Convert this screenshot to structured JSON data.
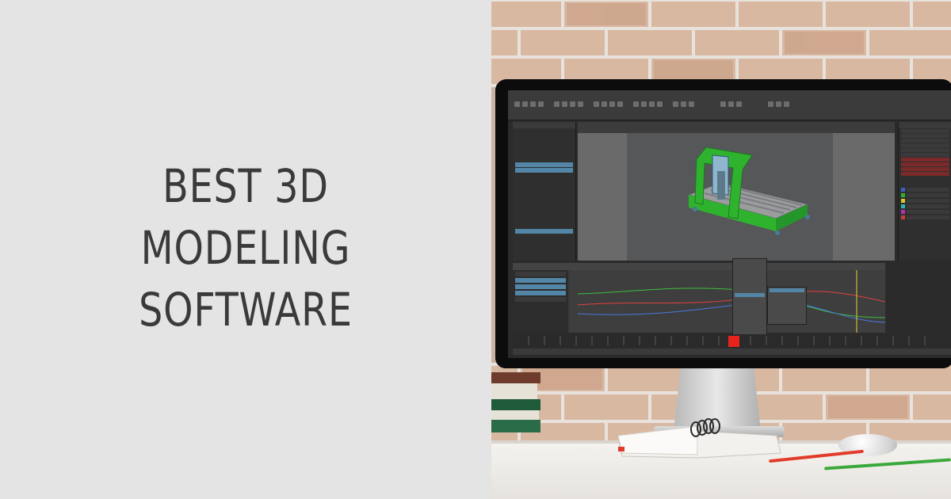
{
  "headline": {
    "line1": "BEST  3D",
    "line2": "MODELING",
    "line3": "SOFTWARE"
  },
  "colors": {
    "left_background": "#e4e4e4",
    "headline_text": "#3a3a3a",
    "model_green": "#2fb32f",
    "model_grey": "#9c9ea0",
    "timeline_marker": "#e8231c",
    "selection_blue": "#5285a6"
  },
  "photo": {
    "description_icons": [
      "monitor-icon",
      "brick-wall",
      "notebook-icon",
      "mouse-icon",
      "pencil-icon"
    ]
  }
}
